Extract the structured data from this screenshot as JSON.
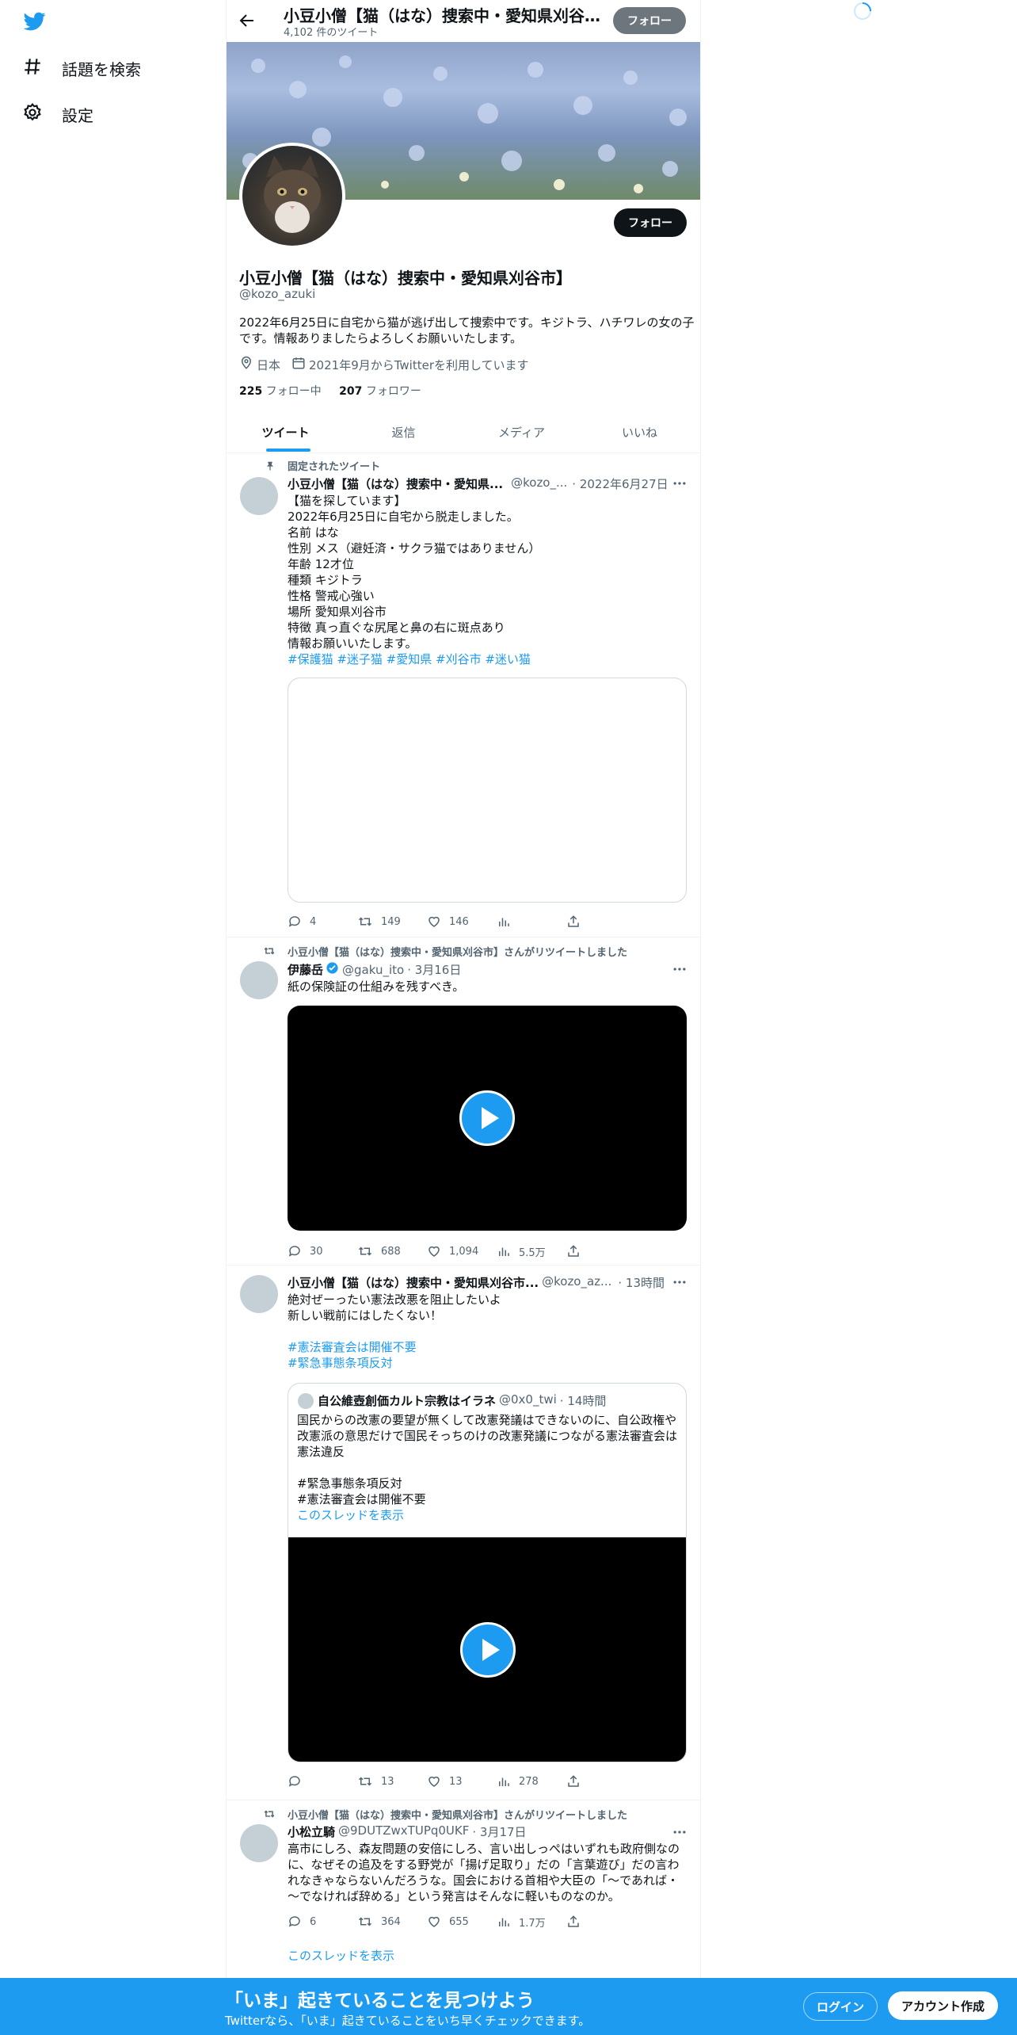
{
  "nav": {
    "explore_label": "話題を検索",
    "settings_label": "設定"
  },
  "header": {
    "title": "小豆小僧【猫（はな）捜索中・愛知県刈谷市…",
    "tweet_count": "4,102 件のツイート",
    "follow_label": "フォロー"
  },
  "profile": {
    "name": "小豆小僧【猫（はな）捜索中・愛知県刈谷市】",
    "handle": "@kozo_azuki",
    "bio_line1": "2022年6月25日に自宅から猫が逃げ出して捜索中です。キジトラ、ハチワレの女の子",
    "bio_line2": "です。情報ありましたらよろしくお願いいたします。",
    "location": "日本",
    "joined": "2021年9月からTwitterを利用しています",
    "following_count": "225",
    "following_label": " フォロー中",
    "followers_count": "207",
    "followers_label": " フォロワー",
    "follow_label": "フォロー"
  },
  "tabs": [
    {
      "label": "ツイート"
    },
    {
      "label": "返信"
    },
    {
      "label": "メディア"
    },
    {
      "label": "いいね"
    }
  ],
  "tweets": [
    {
      "pinned_label": "固定されたツイート",
      "author": "小豆小僧【猫（はな）捜索中・愛知県...",
      "handle": "@kozo_...",
      "time": "· 2022年6月27日",
      "lines": [
        "【猫を探しています】",
        "2022年6月25日に自宅から脱走しました。",
        "名前 はな",
        "性別 メス（避妊済・サクラ猫ではありません）",
        "年齢 12才位",
        "種類 キジトラ",
        "性格 警戒心強い",
        "場所 愛知県刈谷市",
        "特徴 真っ直ぐな尻尾と鼻の右に斑点あり",
        "情報お願いいたします。"
      ],
      "hashtags": "#保護猫 #迷子猫 #愛知県 #刈谷市 #迷い猫",
      "replies": "4",
      "retweets": "149",
      "likes": "146"
    },
    {
      "retweet_label": "小豆小僧【猫（はな）捜索中・愛知県刈谷市】さんがリツイートしました",
      "author": "伊藤岳",
      "handle": "@gaku_ito",
      "time": "· 3月16日",
      "text": "紙の保険証の仕組みを残すべき。",
      "replies": "30",
      "retweets": "688",
      "likes": "1,094",
      "views": "5.5万"
    },
    {
      "author": "小豆小僧【猫（はな）捜索中・愛知県刈谷市...",
      "handle": "@kozo_az...",
      "time": "· 13時間",
      "line1": "絶対ぜーったい憲法改悪を阻止したいよ",
      "line2": "新しい戦前にはしたくない！",
      "tag1": "#憲法審査会は開催不要",
      "tag2": "#緊急事態条項反対",
      "quote": {
        "author": "自公維壺創価カルト宗教はイラネ",
        "handle": "@0x0_twi",
        "time": "· 14時間",
        "line1": "国民からの改憲の要望が無くして改憲発議はできないのに、自公政権や",
        "line2": "改憲派の意思だけで国民そっちのけの改憲発議につながる憲法審査会は",
        "line3": "憲法違反",
        "tag1": "#緊急事態条項反対",
        "tag2": "#憲法審査会は開催不要",
        "show_thread": "このスレッドを表示"
      },
      "retweets": "13",
      "likes": "13",
      "views": "278"
    },
    {
      "retweet_label": "小豆小僧【猫（はな）捜索中・愛知県刈谷市】さんがリツイートしました",
      "author": "小松立騎",
      "handle": "@9DUTZwxTUPq0UKF",
      "time": "· 3月17日",
      "line1": "高市にしろ、森友問題の安倍にしろ、言い出しっぺはいずれも政府側なの",
      "line2": "に、なぜその追及をする野党が「揚げ足取り」だの「言葉遊び」だの言わ",
      "line3": "れなきゃならないんだろうな。国会における首相や大臣の「～であれば・",
      "line4": "～でなければ辞める」という発言はそんなに軽いものなのか。",
      "replies": "6",
      "retweets": "364",
      "likes": "655",
      "views": "1.7万",
      "show_thread": "このスレッドを表示"
    }
  ],
  "bottom_bar": {
    "headline": "「いま」起きていることを見つけよう",
    "sub": "Twitterなら、「いま」起きていることをいち早くチェックできます。",
    "login_label": "ログイン",
    "signup_label": "アカウント作成"
  },
  "colors": {
    "accent": "#1d9bf0",
    "text": "#0f1419",
    "muted": "#536471"
  }
}
